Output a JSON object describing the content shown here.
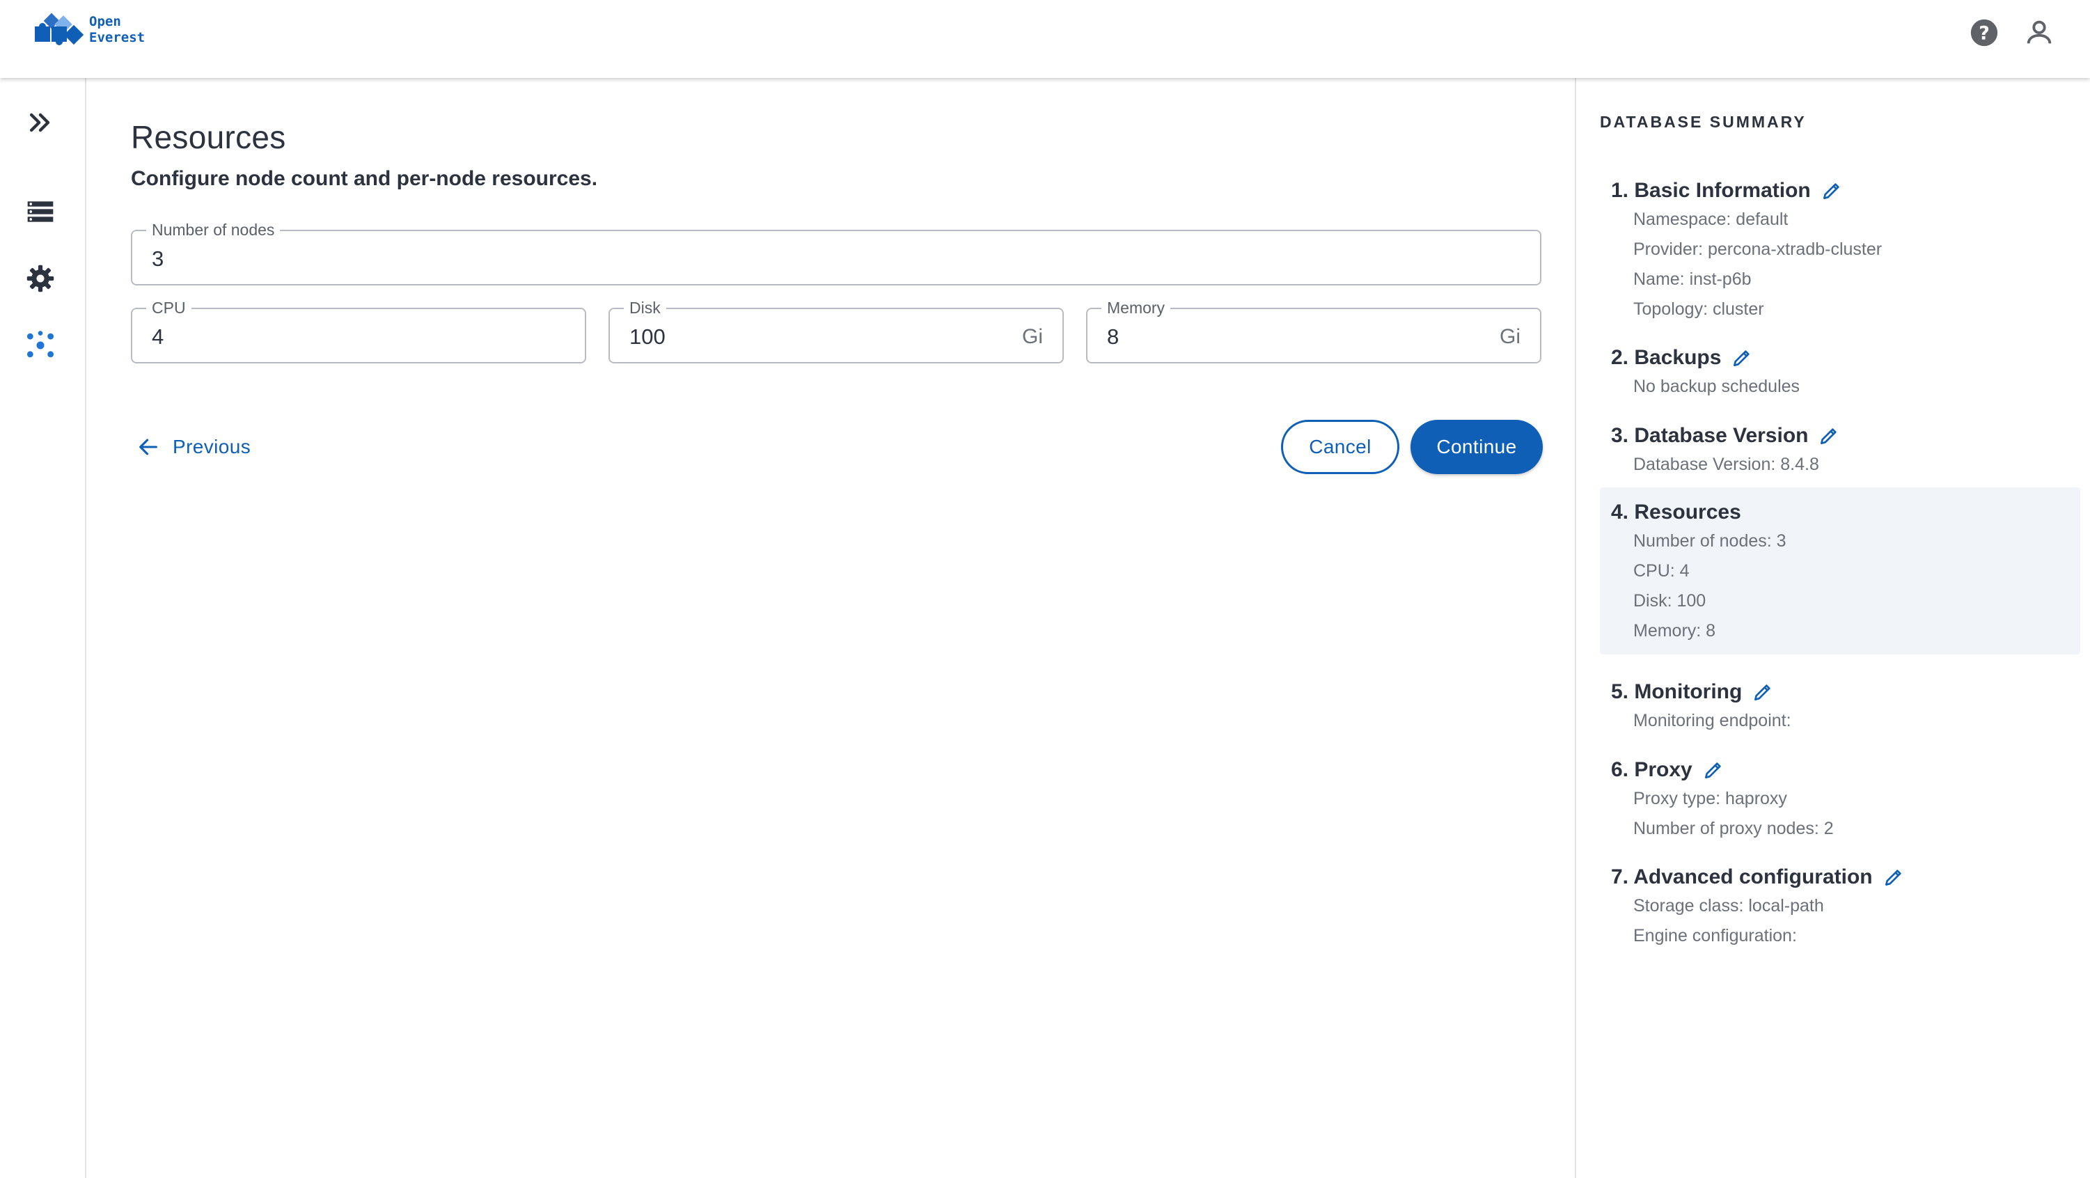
{
  "brand": {
    "line1": "Open",
    "line2": "Everest"
  },
  "colors": {
    "accent": "#0e5fb5",
    "text": "#2c323e",
    "muted": "#6b7079",
    "active_bg": "#f1f5fa"
  },
  "icons": {
    "help": "help-icon",
    "account": "account-icon",
    "expand": "expand-icon",
    "databases": "database-list-icon",
    "settings": "gear-icon",
    "nodes": "nodes-icon",
    "back": "arrow-left-icon",
    "edit": "pencil-icon"
  },
  "page": {
    "title": "Resources",
    "subtitle": "Configure node count and per-node resources."
  },
  "form": {
    "nodes": {
      "label": "Number of nodes",
      "value": "3"
    },
    "cpu": {
      "label": "CPU",
      "value": "4"
    },
    "disk": {
      "label": "Disk",
      "value": "100",
      "unit": "Gi"
    },
    "memory": {
      "label": "Memory",
      "value": "8",
      "unit": "Gi"
    }
  },
  "actions": {
    "previous": "Previous",
    "cancel": "Cancel",
    "continue": "Continue"
  },
  "summary": {
    "heading": "DATABASE SUMMARY",
    "sections": [
      {
        "title": "1. Basic Information",
        "items": [
          "Namespace: default",
          "Provider: percona-xtradb-cluster",
          "Name: inst-p6b",
          "Topology: cluster"
        ]
      },
      {
        "title": "2. Backups",
        "items": [
          "No backup schedules"
        ]
      },
      {
        "title": "3. Database Version",
        "items": [
          "Database Version: 8.4.8"
        ]
      },
      {
        "title": "4. Resources",
        "items": [
          "Number of nodes: 3",
          "CPU: 4",
          "Disk: 100",
          "Memory: 8"
        ]
      },
      {
        "title": "5. Monitoring",
        "items": [
          "Monitoring endpoint:"
        ]
      },
      {
        "title": "6. Proxy",
        "items": [
          "Proxy type: haproxy",
          "Number of proxy nodes: 2"
        ]
      },
      {
        "title": "7. Advanced configuration",
        "items": [
          "Storage class: local-path",
          "Engine configuration:"
        ]
      }
    ]
  }
}
